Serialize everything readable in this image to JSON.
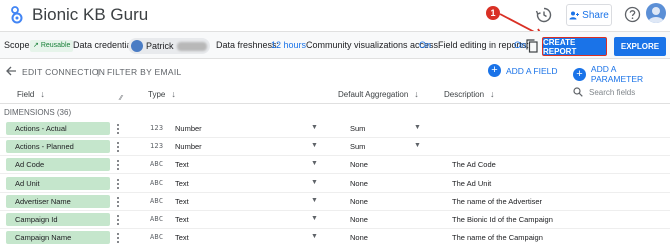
{
  "header": {
    "title": "Bionic KB Guru",
    "share_label": "Share",
    "badge": "1"
  },
  "infobar": {
    "scope_label": "Scope:",
    "reusable_chip": "Reusable",
    "credentials_label": "Data credentials:",
    "credentials_user": "Patrick",
    "freshness_label": "Data freshness:",
    "freshness_value": "12 hours",
    "community_label": "Community visualizations access:",
    "community_value": "On",
    "field_editing_label": "Field editing in reports:",
    "field_editing_value": "On",
    "create_report": "CREATE REPORT",
    "explore": "EXPLORE"
  },
  "editbar": {
    "edit_connection": "EDIT CONNECTION",
    "separator": "|",
    "filter_by_email": "FILTER BY EMAIL",
    "add_field": "ADD A FIELD",
    "add_parameter": "ADD A PARAMETER"
  },
  "columns": {
    "field": "Field",
    "type": "Type",
    "aggregation": "Default Aggregation",
    "description": "Description",
    "search_placeholder": "Search fields"
  },
  "section_label": "DIMENSIONS (36)",
  "rows": [
    {
      "field": "Actions - Actual",
      "type_icon": "123",
      "type": "Number",
      "agg": "Sum",
      "agg_dd": true,
      "desc": ""
    },
    {
      "field": "Actions - Planned",
      "type_icon": "123",
      "type": "Number",
      "agg": "Sum",
      "agg_dd": true,
      "desc": ""
    },
    {
      "field": "Ad Code",
      "type_icon": "ABC",
      "type": "Text",
      "agg": "None",
      "agg_dd": false,
      "desc": "The Ad Code"
    },
    {
      "field": "Ad Unit",
      "type_icon": "ABC",
      "type": "Text",
      "agg": "None",
      "agg_dd": false,
      "desc": "The Ad Unit"
    },
    {
      "field": "Advertiser Name",
      "type_icon": "ABC",
      "type": "Text",
      "agg": "None",
      "agg_dd": false,
      "desc": "The name of the Advertiser"
    },
    {
      "field": "Campaign Id",
      "type_icon": "ABC",
      "type": "Text",
      "agg": "None",
      "agg_dd": false,
      "desc": "The Bionic Id of the Campaign"
    },
    {
      "field": "Campaign Name",
      "type_icon": "ABC",
      "type": "Text",
      "agg": "None",
      "agg_dd": false,
      "desc": "The name of the Campaign"
    }
  ],
  "colors": {
    "accent": "#1a73e8",
    "field_chip": "#c5e6cc",
    "alert": "#d93025"
  },
  "icons": {
    "logo": "looker-studio-logo-icon",
    "history": "history-icon",
    "share": "person-add-icon",
    "help": "help-icon",
    "copy": "copy-icon",
    "back": "arrow-left-icon",
    "search": "search-icon"
  }
}
